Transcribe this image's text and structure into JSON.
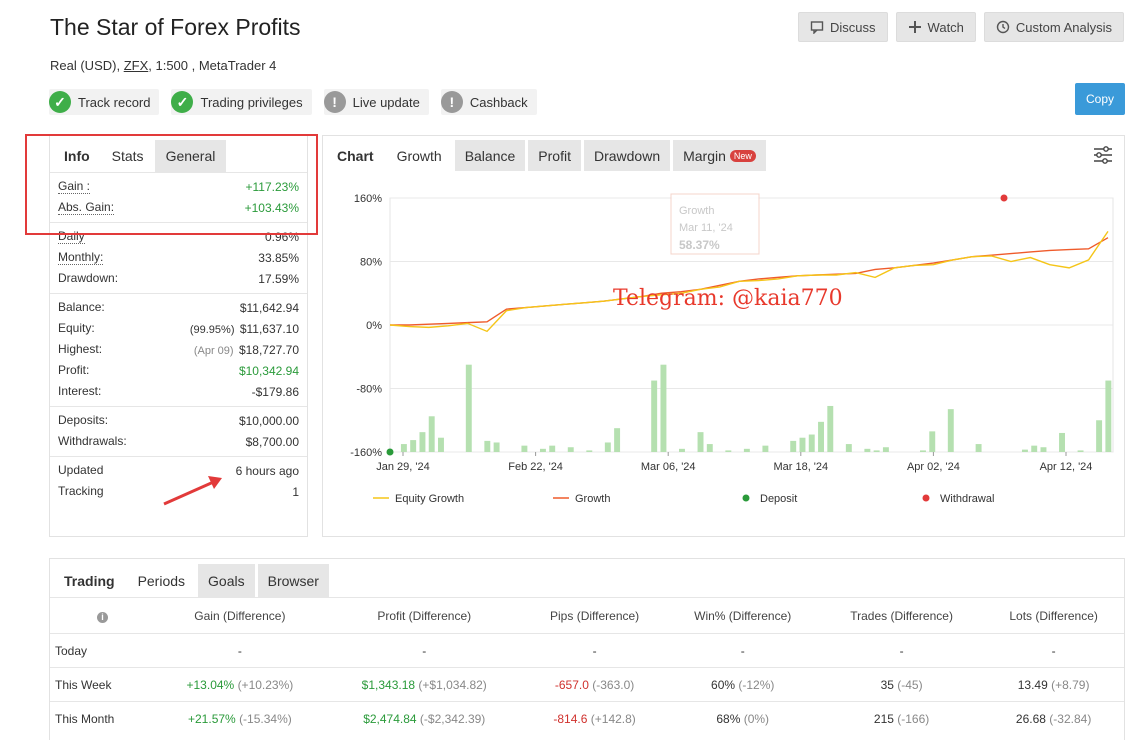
{
  "header": {
    "title": "The Star of Forex Profits",
    "account_type": "Real (USD),",
    "broker": "ZFX",
    "leverage_platform": ", 1:500 , MetaTrader 4",
    "discuss": "Discuss",
    "watch": "Watch",
    "custom_analysis": "Custom Analysis",
    "copy": "Copy"
  },
  "badges": [
    {
      "label": "Track record",
      "status": "ok"
    },
    {
      "label": "Trading privileges",
      "status": "ok"
    },
    {
      "label": "Live update",
      "status": "warn"
    },
    {
      "label": "Cashback",
      "status": "warn"
    }
  ],
  "info": {
    "tabs": [
      "Info",
      "Stats",
      "General"
    ],
    "gain_label": "Gain :",
    "gain": "+117.23%",
    "abs_gain_label": "Abs. Gain:",
    "abs_gain": "+103.43%",
    "daily_label": "Daily",
    "daily": "0.96%",
    "monthly_label": "Monthly:",
    "monthly": "33.85%",
    "drawdown_label": "Drawdown:",
    "drawdown": "17.59%",
    "balance_label": "Balance:",
    "balance": "$11,642.94",
    "equity_label": "Equity:",
    "equity_pct": "(99.95%)",
    "equity": "$11,637.10",
    "highest_label": "Highest:",
    "highest_date": "(Apr 09)",
    "highest": "$18,727.70",
    "profit_label": "Profit:",
    "profit": "$10,342.94",
    "interest_label": "Interest:",
    "interest": "-$179.86",
    "deposits_label": "Deposits:",
    "deposits": "$10,000.00",
    "withdrawals_label": "Withdrawals:",
    "withdrawals": "$8,700.00",
    "updated_label": "Updated",
    "updated": "6 hours ago",
    "tracking_label": "Tracking",
    "tracking": "1"
  },
  "chart_tabs": [
    "Chart",
    "Growth",
    "Balance",
    "Profit",
    "Drawdown",
    "Margin"
  ],
  "new_tag": "New",
  "watermark": "Telegram: @kaia770",
  "tooltip": {
    "title": "Growth",
    "date": "Mar 11, '24",
    "value": "58.37%"
  },
  "chart_data": {
    "type": "line",
    "y_ticks": [
      "160%",
      "80%",
      "0%",
      "-80%",
      "-160%"
    ],
    "ylim": [
      -160,
      160
    ],
    "x_ticks": [
      "Jan 29, '24",
      "Feb 22, '24",
      "Mar 06, '24",
      "Mar 18, '24",
      "Apr 02, '24",
      "Apr 12, '24"
    ],
    "legend": [
      "Equity Growth",
      "Growth",
      "Deposit",
      "Withdrawal"
    ],
    "colors": {
      "equity": "#f5c518",
      "growth": "#ef5b2b",
      "deposit": "#2a9a3a",
      "withdrawal": "#e23a3a",
      "bars": "#b5e0b0"
    },
    "series": [
      {
        "name": "Growth",
        "values": [
          0,
          0,
          1,
          2,
          3,
          4,
          20,
          22,
          24,
          26,
          28,
          30,
          33,
          36,
          40,
          42,
          45,
          50,
          55,
          58,
          60,
          62,
          63,
          64,
          65,
          70,
          72,
          75,
          78,
          82,
          86,
          88,
          90,
          92,
          94,
          95,
          96,
          110
        ]
      },
      {
        "name": "Equity Growth",
        "values": [
          0,
          -2,
          -3,
          -1,
          2,
          -8,
          18,
          22,
          24,
          26,
          28,
          30,
          33,
          36,
          38,
          40,
          45,
          48,
          55,
          56,
          58,
          62,
          63,
          63,
          66,
          60,
          72,
          75,
          76,
          82,
          86,
          87,
          80,
          85,
          76,
          72,
          82,
          118
        ]
      }
    ],
    "bars": [
      0,
      10,
      15,
      25,
      45,
      18,
      0,
      0,
      110,
      0,
      14,
      12,
      0,
      0,
      8,
      0,
      4,
      8,
      0,
      6,
      0,
      2,
      0,
      12,
      30,
      0,
      0,
      0,
      90,
      110,
      0,
      4,
      0,
      25,
      10,
      0,
      2,
      0,
      4,
      0,
      8,
      0,
      0,
      14,
      18,
      22,
      38,
      58,
      0,
      10,
      0,
      4,
      2,
      6,
      0,
      0,
      0,
      2,
      26,
      0,
      54,
      0,
      0,
      10,
      0,
      0,
      0,
      0,
      3,
      8,
      6,
      0,
      24,
      0,
      2,
      0,
      40,
      90
    ]
  },
  "periods": {
    "tabs": [
      "Trading",
      "Periods",
      "Goals",
      "Browser"
    ],
    "info_icon_glyph": "i",
    "headers": [
      "Gain (Difference)",
      "Profit (Difference)",
      "Pips (Difference)",
      "Win% (Difference)",
      "Trades (Difference)",
      "Lots (Difference)"
    ],
    "rows": [
      {
        "label": "Today",
        "gain": "-",
        "gain_d": "",
        "profit": "-",
        "profit_d": "",
        "pips": "-",
        "pips_d": "",
        "win": "-",
        "win_d": "",
        "trades": "-",
        "trades_d": "",
        "lots": "-",
        "lots_d": ""
      },
      {
        "label": "This Week",
        "gain": "+13.04%",
        "gain_d": "(+10.23%)",
        "profit": "$1,343.18",
        "profit_d": "(+$1,034.82)",
        "pips": "-657.0",
        "pips_d": "(-363.0)",
        "win": "60%",
        "win_d": "(-12%)",
        "trades": "35",
        "trades_d": "(-45)",
        "lots": "13.49",
        "lots_d": "(+8.79)"
      },
      {
        "label": "This Month",
        "gain": "+21.57%",
        "gain_d": "(-15.34%)",
        "profit": "$2,474.84",
        "profit_d": "(-$2,342.39)",
        "pips": "-814.6",
        "pips_d": "(+142.8)",
        "win": "68%",
        "win_d": "(0%)",
        "trades": "215",
        "trades_d": "(-166)",
        "lots": "26.68",
        "lots_d": "(-32.84)"
      }
    ]
  }
}
